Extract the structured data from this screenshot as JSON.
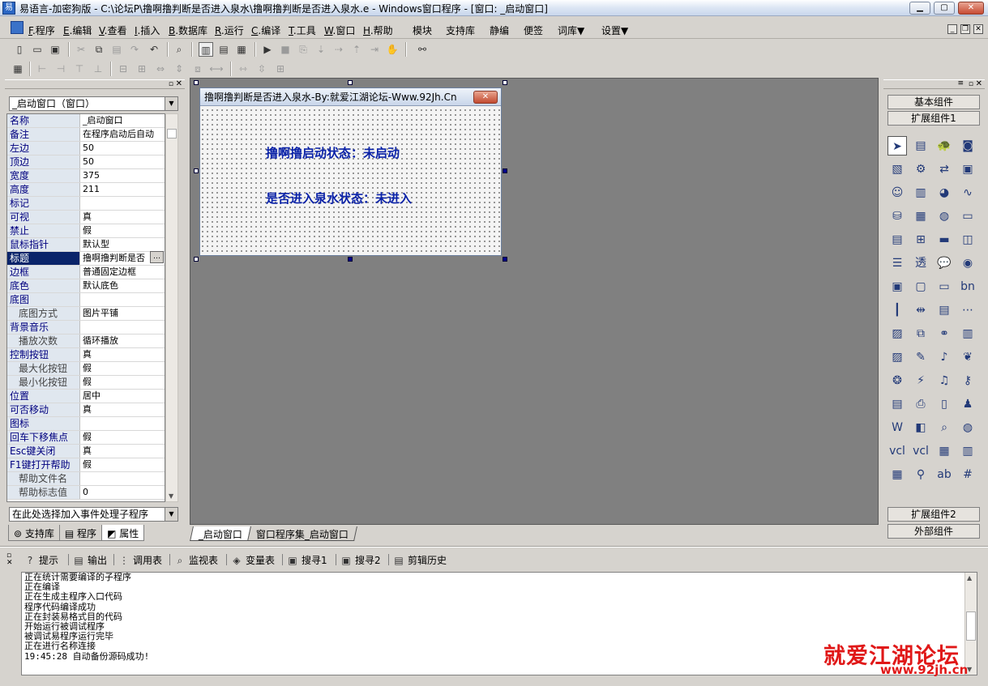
{
  "window": {
    "title": "易语言-加密狗版 - C:\\论坛P\\撸啊撸判断是否进入泉水\\撸啊撸判断是否进入泉水.e - Windows窗口程序 - [窗口: _启动窗口]",
    "app_icon": "易"
  },
  "menu": [
    {
      "key": "F",
      "label": ".程序"
    },
    {
      "key": "E",
      "label": ".编辑"
    },
    {
      "key": "V",
      "label": ".查看"
    },
    {
      "key": "I",
      "label": ".插入"
    },
    {
      "key": "B",
      "label": ".数据库"
    },
    {
      "key": "R",
      "label": ".运行"
    },
    {
      "key": "C",
      "label": ".编译"
    },
    {
      "key": "T",
      "label": ".工具"
    },
    {
      "key": "W",
      "label": ".窗口"
    },
    {
      "key": "H",
      "label": ".帮助"
    },
    {
      "key": "",
      "label": "模块"
    },
    {
      "key": "",
      "label": "支持库"
    },
    {
      "key": "",
      "label": "静编"
    },
    {
      "key": "",
      "label": "便签"
    },
    {
      "key": "",
      "label": "词库▼"
    },
    {
      "key": "",
      "label": "设置▼"
    }
  ],
  "left_panel": {
    "object_combo": "_启动窗口（窗口）",
    "properties": [
      {
        "name": "名称",
        "value": "_启动窗口",
        "sub": false
      },
      {
        "name": "备注",
        "value": "在程序启动后自动",
        "sub": false
      },
      {
        "name": "左边",
        "value": "50",
        "sub": false
      },
      {
        "name": "顶边",
        "value": "50",
        "sub": false
      },
      {
        "name": "宽度",
        "value": "375",
        "sub": false
      },
      {
        "name": "高度",
        "value": "211",
        "sub": false
      },
      {
        "name": "标记",
        "value": "",
        "sub": false
      },
      {
        "name": "可视",
        "value": "真",
        "sub": false
      },
      {
        "name": "禁止",
        "value": "假",
        "sub": false
      },
      {
        "name": "鼠标指针",
        "value": "默认型",
        "sub": false
      },
      {
        "name": "标题",
        "value": "撸啊撸判断是否",
        "sub": false,
        "selected": true
      },
      {
        "name": "边框",
        "value": "普通固定边框",
        "sub": false
      },
      {
        "name": "底色",
        "value": "默认底色",
        "sub": false
      },
      {
        "name": "底图",
        "value": "",
        "sub": false
      },
      {
        "name": "底图方式",
        "value": "图片平铺",
        "sub": true
      },
      {
        "name": "背景音乐",
        "value": "",
        "sub": false
      },
      {
        "name": "播放次数",
        "value": "循环播放",
        "sub": true
      },
      {
        "name": "控制按钮",
        "value": "真",
        "sub": false
      },
      {
        "name": "最大化按钮",
        "value": "假",
        "sub": true
      },
      {
        "name": "最小化按钮",
        "value": "假",
        "sub": true
      },
      {
        "name": "位置",
        "value": "居中",
        "sub": false
      },
      {
        "name": "可否移动",
        "value": "真",
        "sub": false
      },
      {
        "name": "图标",
        "value": "",
        "sub": false
      },
      {
        "name": "回车下移焦点",
        "value": "假",
        "sub": false
      },
      {
        "name": "Esc键关闭",
        "value": "真",
        "sub": false
      },
      {
        "name": "F1键打开帮助",
        "value": "假",
        "sub": false
      },
      {
        "name": "帮助文件名",
        "value": "",
        "sub": true
      },
      {
        "name": "帮助标志值",
        "value": "0",
        "sub": true
      }
    ],
    "event_combo": "在此处选择加入事件处理子程序",
    "tabs": [
      "支持库",
      "程序",
      "属性"
    ],
    "active_tab": "属性"
  },
  "design": {
    "form_title": "撸啊撸判断是否进入泉水-By:就爱江湖论坛-Www.92Jh.Cn",
    "label1": "撸啊撸启动状态：未启动",
    "label2": "是否进入泉水状态：未进入",
    "tabs": [
      "_启动窗口",
      "窗口程序集_启动窗口"
    ],
    "active_tab": "_启动窗口"
  },
  "right_panel": {
    "basic": "基本组件",
    "ext1": "扩展组件1",
    "ext2": "扩展组件2",
    "external": "外部组件",
    "components": [
      {
        "name": "pointer-icon",
        "glyph": "➤"
      },
      {
        "name": "component-icon",
        "glyph": "▤"
      },
      {
        "name": "turtle-icon",
        "glyph": "🐢"
      },
      {
        "name": "camera-icon",
        "glyph": "◙"
      },
      {
        "name": "doc-icon",
        "glyph": "▧"
      },
      {
        "name": "socket-icon",
        "glyph": "⚙"
      },
      {
        "name": "transfer-icon",
        "glyph": "⇄"
      },
      {
        "name": "picture-icon",
        "glyph": "▣"
      },
      {
        "name": "user-icon",
        "glyph": "☺"
      },
      {
        "name": "bar-chart-icon",
        "glyph": "▥"
      },
      {
        "name": "pie-chart-icon",
        "glyph": "◕"
      },
      {
        "name": "line-chart-icon",
        "glyph": "∿"
      },
      {
        "name": "db-icon",
        "glyph": "⛁"
      },
      {
        "name": "grid-icon",
        "glyph": "▦"
      },
      {
        "name": "gauge-icon",
        "glyph": "◍"
      },
      {
        "name": "label-icon",
        "glyph": "▭"
      },
      {
        "name": "table-icon",
        "glyph": "▤"
      },
      {
        "name": "tree-icon",
        "glyph": "⊞"
      },
      {
        "name": "ruler-icon",
        "glyph": "▬"
      },
      {
        "name": "frame-icon",
        "glyph": "◫"
      },
      {
        "name": "list-icon",
        "glyph": "☰"
      },
      {
        "name": "transparent-icon",
        "glyph": "透"
      },
      {
        "name": "bubble-icon",
        "glyph": "💬"
      },
      {
        "name": "html-icon",
        "glyph": "◉"
      },
      {
        "name": "form-icon",
        "glyph": "▣"
      },
      {
        "name": "folder-icon",
        "glyph": "▢"
      },
      {
        "name": "progress-icon",
        "glyph": "▭"
      },
      {
        "name": "bn-icon",
        "glyph": "bn"
      },
      {
        "name": "vscroll-icon",
        "glyph": "┃"
      },
      {
        "name": "split-icon",
        "glyph": "⇹"
      },
      {
        "name": "status-icon",
        "glyph": "▤"
      },
      {
        "name": "dots-icon",
        "glyph": "⋯"
      },
      {
        "name": "image-icon",
        "glyph": "▨"
      },
      {
        "name": "copy-icon",
        "glyph": "⧉"
      },
      {
        "name": "link-icon",
        "glyph": "⚭"
      },
      {
        "name": "panel-icon",
        "glyph": "▥"
      },
      {
        "name": "dialog-icon",
        "glyph": "▨"
      },
      {
        "name": "edit-icon",
        "glyph": "✎"
      },
      {
        "name": "midi-icon",
        "glyph": "♪"
      },
      {
        "name": "plant-icon",
        "glyph": "❦"
      },
      {
        "name": "network-icon",
        "glyph": "❂"
      },
      {
        "name": "signal-icon",
        "glyph": "⚡"
      },
      {
        "name": "mp3-icon",
        "glyph": "♫"
      },
      {
        "name": "key-icon",
        "glyph": "⚷"
      },
      {
        "name": "text-icon",
        "glyph": "▤"
      },
      {
        "name": "printer-icon",
        "glyph": "⎙"
      },
      {
        "name": "file-icon",
        "glyph": "▯"
      },
      {
        "name": "people-icon",
        "glyph": "♟"
      },
      {
        "name": "word-icon",
        "glyph": "W"
      },
      {
        "name": "doc2-icon",
        "glyph": "◧"
      },
      {
        "name": "search-icon",
        "glyph": "⌕"
      },
      {
        "name": "globe-icon",
        "glyph": "◍"
      },
      {
        "name": "vcl-icon",
        "glyph": "vcl"
      },
      {
        "name": "vcl2-icon",
        "glyph": "vcl"
      },
      {
        "name": "calendar-icon",
        "glyph": "▦"
      },
      {
        "name": "barcode-icon",
        "glyph": "▥"
      },
      {
        "name": "palette-icon",
        "glyph": "▦"
      },
      {
        "name": "magnify-icon",
        "glyph": "⚲"
      },
      {
        "name": "label-ab-icon",
        "glyph": "ab"
      },
      {
        "name": "hash-icon",
        "glyph": "#"
      }
    ]
  },
  "bottom": {
    "tabs": [
      {
        "icon": "hint-icon",
        "glyph": "?",
        "label": "提示"
      },
      {
        "icon": "output-icon",
        "glyph": "▤",
        "label": "输出"
      },
      {
        "icon": "calltable-icon",
        "glyph": "⋮",
        "label": "调用表"
      },
      {
        "icon": "watch-icon",
        "glyph": "⌕",
        "label": "监视表"
      },
      {
        "icon": "variable-icon",
        "glyph": "◈",
        "label": "变量表"
      },
      {
        "icon": "find1-icon",
        "glyph": "▣",
        "label": "搜寻1"
      },
      {
        "icon": "find2-icon",
        "glyph": "▣",
        "label": "搜寻2"
      },
      {
        "icon": "clipboard-icon",
        "glyph": "▤",
        "label": "剪辑历史"
      }
    ],
    "output_lines": [
      "正在统计需要编译的子程序",
      "正在编译",
      "正在生成主程序入口代码",
      "程序代码编译成功",
      "正在封装易格式目的代码",
      "开始运行被调试程序",
      "被调试易程序运行完毕",
      "正在进行名称连接",
      "19:45:28 自动备份源码成功!"
    ]
  },
  "watermark": {
    "main": "就爱江湖论坛",
    "url": "www.92jh.cn"
  }
}
